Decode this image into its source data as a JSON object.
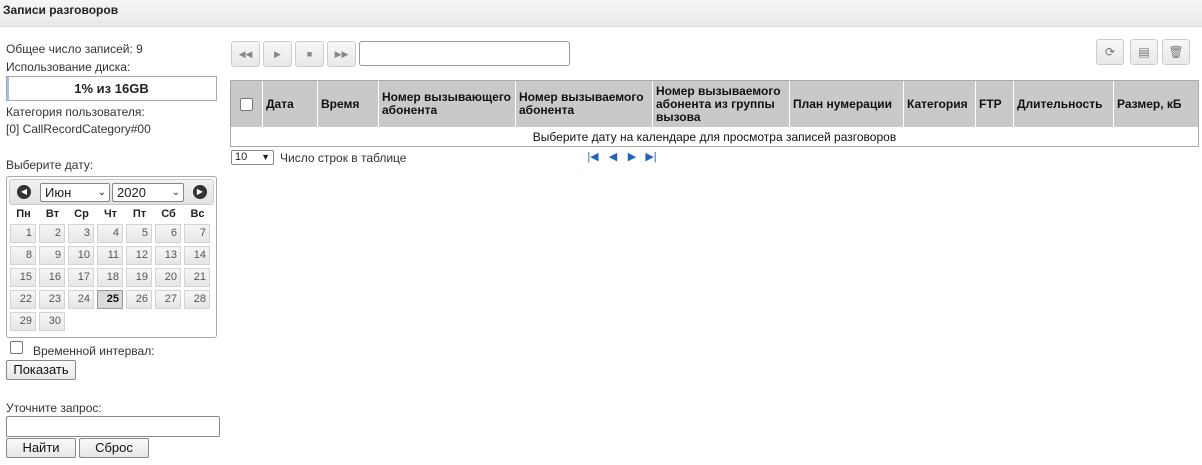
{
  "window": {
    "title": "Записи разговоров"
  },
  "sidebar": {
    "total_records_label": "Общее число записей:",
    "total_records_value": "9",
    "disk_usage_label": "Использование диска:",
    "disk_usage_text": "1% из 16GB",
    "disk_usage_fraction": 0.01,
    "user_category_label": "Категория пользователя:",
    "user_category_value": "[0] CallRecordCategory#00",
    "select_date_label": "Выберите дату:",
    "time_interval_label": "Временной интервал:",
    "time_interval_checked": false,
    "show_button": "Показать",
    "refine_query_label": "Уточните запрос:",
    "refine_query_value": "",
    "find_button": "Найти",
    "reset_button": "Сброс"
  },
  "calendar": {
    "month": "Июн",
    "year": "2020",
    "weekdays": [
      "Пн",
      "Вт",
      "Ср",
      "Чт",
      "Пт",
      "Сб",
      "Вс"
    ],
    "first_weekday_index": 0,
    "days_in_month": 30,
    "selected_day": 25
  },
  "player": {
    "rewind_icon": "rewind-icon",
    "play_icon": "play-icon",
    "stop_icon": "stop-icon",
    "forward_icon": "fast-forward-icon",
    "track_value": ""
  },
  "toolbar": {
    "refresh_icon": "refresh-icon",
    "save_icon": "save-icon",
    "delete_icon": "trash-icon"
  },
  "table": {
    "columns": [
      "Дата",
      "Время",
      "Номер вызывающего абонента",
      "Номер вызываемого абонента",
      "Номер вызываемого абонента из группы вызова",
      "План нумерации",
      "Категория",
      "FTP",
      "Длительность",
      "Размер, кБ"
    ],
    "empty_message": "Выберите дату на календаре для просмотра записей разговоров",
    "rows_per_page": "10",
    "rows_per_page_label": "Число строк в таблице"
  },
  "colors": {
    "header_bg": "#c9c9c9",
    "pager_accent": "#1e62c7",
    "disk_fill": "#9fc3e8"
  }
}
